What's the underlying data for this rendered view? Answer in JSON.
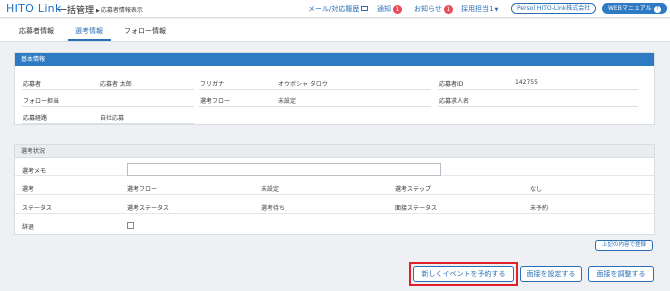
{
  "header": {
    "logo": "HITO Link",
    "module": "一括管理",
    "breadcrumb": "応募者情報表示",
    "mail_link": "メール/対応履歴",
    "notice_label": "通知",
    "notice_count": "1",
    "info_label": "お知らせ",
    "info_count": "1",
    "user_menu": "採用担当1",
    "company": "Persol HITO-Link株式会社",
    "manual": "WEBマニュアル"
  },
  "tabs": [
    "応募者情報",
    "選考情報",
    "フォロー情報"
  ],
  "basic": {
    "title": "基本情報",
    "applicant_label": "応募者",
    "applicant_value": "応募者 太郎",
    "furigana_label": "フリガナ",
    "furigana_value": "オウボシャ タロウ",
    "id_label": "応募者ID",
    "id_value": "142755",
    "follow_label": "フォロー担当",
    "flow_label": "選考フロー",
    "flow_value": "未設定",
    "job_label": "応募求人名",
    "route_label": "応募経路",
    "route_value": "自社応募"
  },
  "selection": {
    "title": "選考状況",
    "memo_label": "選考メモ",
    "memo_value": "",
    "stage_label": "選考",
    "flow_label": "選考フロー",
    "flow_value": "未設定",
    "step_label": "選考ステップ",
    "step_value": "なし",
    "status_label": "ステータス",
    "sel_status_label": "選考ステータス",
    "sel_status_value": "選考待ち",
    "interview_status_label": "面接ステータス",
    "interview_status_value": "未予約",
    "decline_label": "辞退"
  },
  "buttons": {
    "register": "上記の内容で登録",
    "new_event": "新しくイベントを予約する",
    "set_interview": "面接を設定する",
    "adjust_interview": "面接を調整する"
  },
  "colors": {
    "accent": "#2f7bc3",
    "badge": "#e94b5a",
    "highlight": "#e0202a"
  }
}
